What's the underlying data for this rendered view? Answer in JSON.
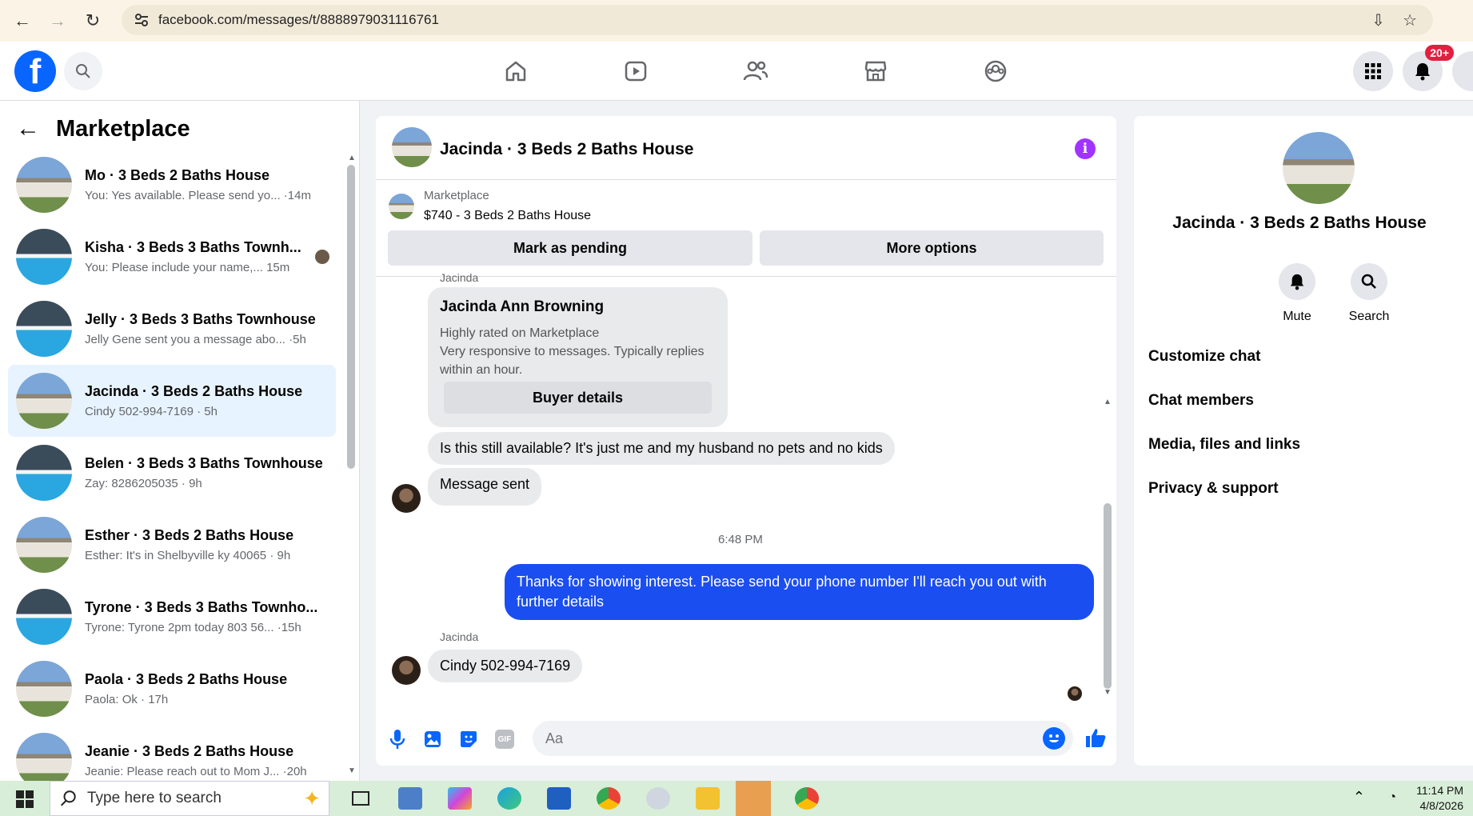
{
  "browser": {
    "url": "facebook.com/messages/t/8888979031116761"
  },
  "fb_nav": {
    "notification_badge": "20+"
  },
  "sidebar": {
    "title": "Marketplace",
    "items": [
      {
        "title": "Mo · 3 Beds 2 Baths House",
        "sub": "You: Yes available. Please send yo... ·14m",
        "thumb": "house"
      },
      {
        "title": "Kisha · 3 Beds 3 Baths Townh...",
        "sub": "You: Please include your name,... 15m",
        "thumb": "pool"
      },
      {
        "title": "Jelly · 3 Beds 3 Baths Townhouse",
        "sub": "Jelly Gene sent you a message abo... ·5h",
        "thumb": "pool"
      },
      {
        "title": "Jacinda · 3 Beds 2 Baths House",
        "sub": "Cindy 502-994-7169 · 5h",
        "thumb": "house"
      },
      {
        "title": "Belen · 3 Beds 3 Baths Townhouse",
        "sub": "Zay: 8286205035 · 9h",
        "thumb": "pool"
      },
      {
        "title": "Esther · 3 Beds 2 Baths House",
        "sub": "Esther: It's in Shelbyville ky 40065 · 9h",
        "thumb": "house"
      },
      {
        "title": "Tyrone · 3 Beds 3 Baths Townho...",
        "sub": "Tyrone: Tyrone 2pm today 803 56... ·15h",
        "thumb": "pool"
      },
      {
        "title": "Paola · 3 Beds 2 Baths House",
        "sub": "Paola: Ok · 17h",
        "thumb": "house"
      },
      {
        "title": "Jeanie · 3 Beds 2 Baths House",
        "sub": "Jeanie: Please reach out to Mom J... ·20h",
        "thumb": "house"
      }
    ]
  },
  "chat": {
    "title": "Jacinda · 3 Beds 2 Baths House",
    "marketplace_label": "Marketplace",
    "listing": "$740 - 3 Beds 2 Baths House",
    "btn_pending": "Mark as pending",
    "btn_more": "More options",
    "top_sender": "Jacinda",
    "card": {
      "name": "Jacinda Ann Browning",
      "line1": "Highly rated on Marketplace",
      "line2": "Very responsive to messages. Typically replies within an hour.",
      "button": "Buyer details"
    },
    "msg1": "Is this still available? It's just me and my husband no pets and no kids",
    "msg2": "Message sent",
    "time_divider": "6:48 PM",
    "msg_out": "Thanks for showing interest. Please send your phone number  I'll reach you out with further details",
    "sender2": "Jacinda",
    "msg3": "Cindy 502-994-7169",
    "composer_placeholder": "Aa",
    "gif_label": "GIF"
  },
  "right_panel": {
    "title": "Jacinda · 3 Beds 2 Baths House",
    "mute_label": "Mute",
    "search_label": "Search",
    "menu": [
      "Customize chat",
      "Chat members",
      "Media, files and links",
      "Privacy & support"
    ]
  },
  "taskbar": {
    "search_placeholder": "Type here to search",
    "time": "11:14 PM",
    "date": "4/8/2026"
  }
}
